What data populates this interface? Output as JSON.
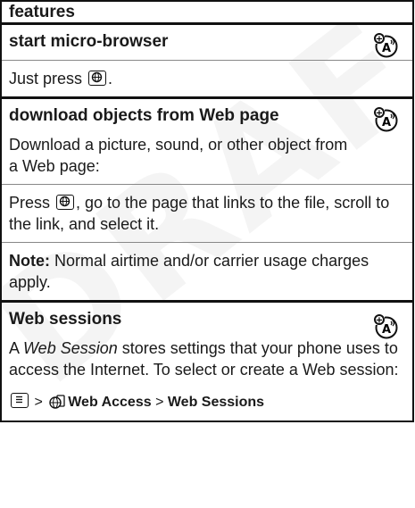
{
  "header": {
    "title": "features"
  },
  "sections": [
    {
      "title": "start micro-browser",
      "paragraphs": [
        {
          "before": "Just press ",
          "after": "."
        }
      ]
    },
    {
      "title": "download objects from Web page",
      "paragraphs": [
        {
          "text": "Download a picture, sound, or other object from a Web page:"
        },
        {
          "before": "Press ",
          "after": ", go to the page that links to the file, scroll to the link, and select it."
        },
        {
          "note_label": "Note:",
          "note_text": " Normal airtime and/or carrier usage charges apply."
        }
      ]
    },
    {
      "title": "Web sessions",
      "intro_before": "A ",
      "intro_italic": "Web Session",
      "intro_after": " stores settings that your phone uses to access the Internet. To select or create a Web session:",
      "path": {
        "sep1": " > ",
        "item1": "Web Access",
        "sep2": " > ",
        "item2": "Web Sessions"
      }
    }
  ],
  "watermark": "DRAFT",
  "icons": [
    "network-feature-icon",
    "browser-key-icon",
    "menu-key-icon",
    "web-access-icon"
  ]
}
